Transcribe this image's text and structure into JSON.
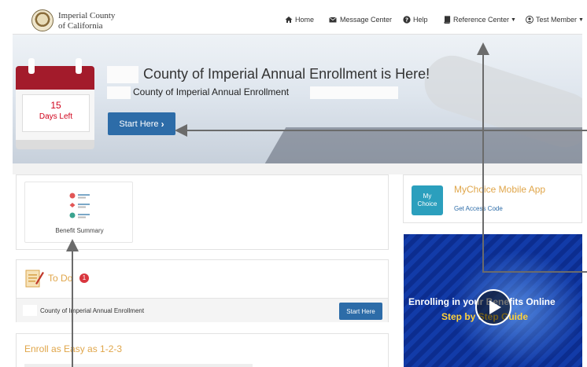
{
  "header": {
    "org_line1": "Imperial County",
    "org_line2": "of California",
    "nav": [
      {
        "label": "Home",
        "icon": "home-icon"
      },
      {
        "label": "Message Center",
        "icon": "envelope-icon"
      },
      {
        "label": "Help",
        "icon": "question-icon"
      },
      {
        "label": "Reference Center",
        "icon": "book-icon",
        "dropdown": true
      },
      {
        "label": "Test Member",
        "icon": "user-icon",
        "dropdown": true
      }
    ]
  },
  "hero": {
    "title": "County of Imperial Annual Enrollment is Here!",
    "subtitle": "County of Imperial Annual Enrollment",
    "days_number": "15",
    "days_label": "Days Left",
    "start_button": "Start Here"
  },
  "tiles": [
    {
      "label": "Benefit Summary",
      "icon": "benefit-summary-icon"
    }
  ],
  "todo": {
    "title": "To Do",
    "badge": "1",
    "item_text": "County of Imperial Annual Enrollment",
    "item_button": "Start Here"
  },
  "enroll": {
    "title": "Enroll as Easy as 1-2-3"
  },
  "app": {
    "icon_text_1": "My",
    "icon_text_2": "Choice",
    "title": "MyChoice Mobile App",
    "link": "Get Access Code"
  },
  "video": {
    "line1": "Enrolling in your Benefits Online",
    "line2": "Step by Step Guide"
  },
  "colors": {
    "accent_blue": "#2d6ca8",
    "heading_gold": "#e0a64a",
    "calendar_red": "#a31b2b",
    "video_blue": "#0c2d8f"
  }
}
